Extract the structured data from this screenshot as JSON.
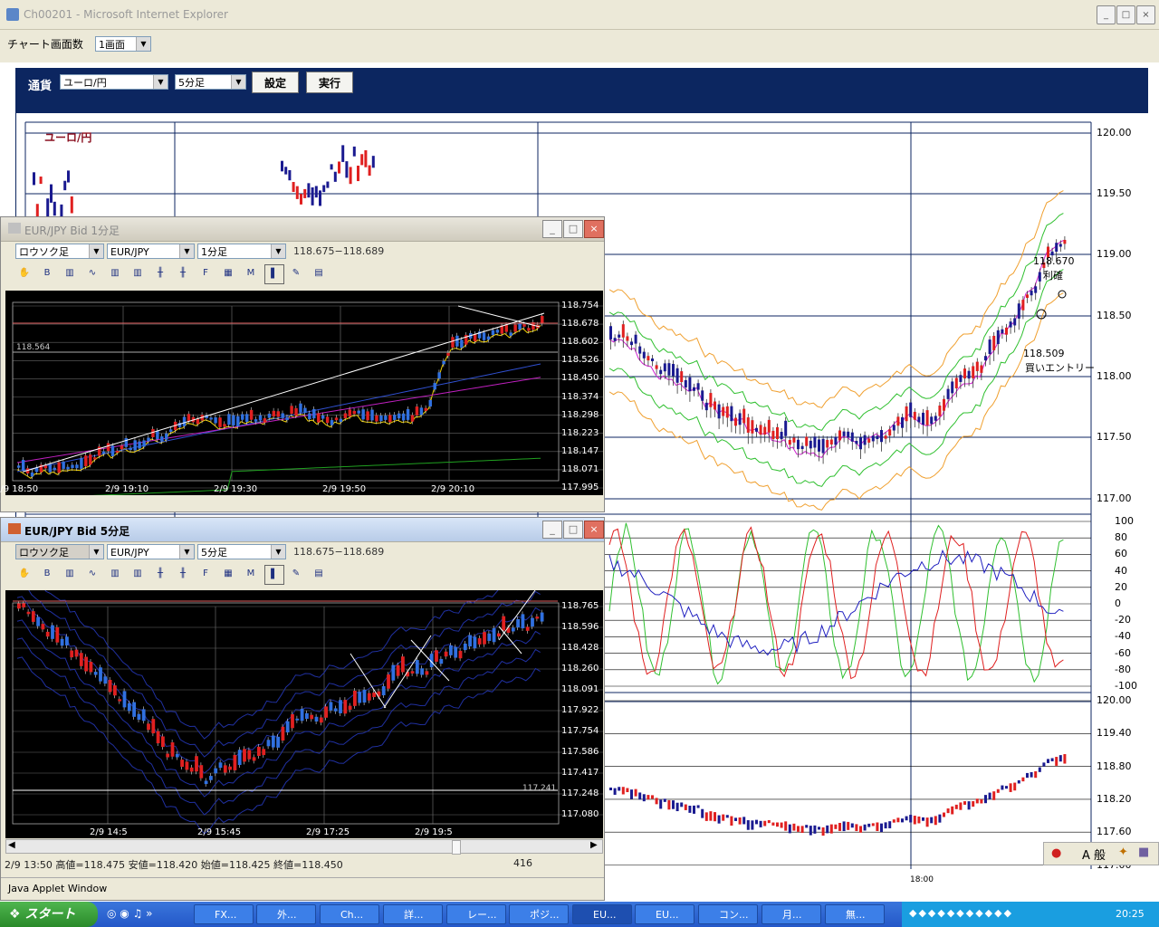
{
  "ie": {
    "title": "Ch00201 - Microsoft Internet Explorer"
  },
  "page": {
    "screens_label": "チャート画面数",
    "screens_value": "1画面"
  },
  "toolbar": {
    "currency_label": "通貨",
    "currency_value": "ユーロ/円",
    "interval_value": "5分足",
    "set_button": "設定",
    "run_button": "実行"
  },
  "main_chart": {
    "title": "ユーロ/円",
    "price_ticks": [
      "120.00",
      "119.50",
      "119.00",
      "118.50",
      "118.00",
      "117.50",
      "117.00"
    ],
    "annotation_sell_price": "118.670",
    "annotation_sell_label": "利確",
    "annotation_buy_price": "118.509",
    "annotation_buy_label": "買いエントリー",
    "osc_ticks": [
      "100",
      "80",
      "60",
      "40",
      "20",
      "0",
      "-20",
      "-40",
      "-60",
      "-80",
      "-100"
    ],
    "bottom_ticks": [
      "120.00",
      "119.40",
      "118.80",
      "118.20",
      "117.60",
      "117.00"
    ],
    "time_label": "18:00"
  },
  "win1": {
    "title": "EUR/JPY  Bid  1分足",
    "type_select": "ロウソク足",
    "pair_select": "EUR/JPY",
    "interval_select": "1分足",
    "range": "118.675−118.689",
    "hline_label": "118.564",
    "y_ticks": [
      "118.754",
      "118.678",
      "118.602",
      "118.526",
      "118.450",
      "118.374",
      "118.298",
      "118.223",
      "118.147",
      "118.071",
      "117.995"
    ],
    "x_ticks": [
      "2/9 18:50",
      "2/9 19:10",
      "2/9 19:30",
      "2/9 19:50",
      "2/9 20:10"
    ]
  },
  "win2": {
    "title": "EUR/JPY  Bid  5分足",
    "type_select": "ロウソク足",
    "pair_select": "EUR/JPY",
    "interval_select": "5分足",
    "range": "118.675−118.689",
    "low_label": "117.241",
    "y_ticks": [
      "118.765",
      "118.596",
      "118.428",
      "118.260",
      "118.091",
      "117.922",
      "117.754",
      "117.586",
      "117.417",
      "117.248",
      "117.080"
    ],
    "x_ticks": [
      "2/9 14:5",
      "2/9 15:45",
      "2/9 17:25",
      "2/9 19:5"
    ],
    "status_left": "2/9 13:50   高値=118.475  安値=118.420  始値=118.425  終値=118.450",
    "status_right": "416",
    "java_label": "Java Applet Window"
  },
  "tray_icons": {
    "lang": "A 般"
  },
  "taskbar": {
    "start": "スタート",
    "tasks": [
      "FX...",
      "外...",
      "Ch...",
      "詳...",
      "レー...",
      "ポジ...",
      "EU...",
      "EU...",
      "コン...",
      "月...",
      "無..."
    ],
    "clock": "20:25"
  },
  "colors": {
    "candle_up": "#e02020",
    "candle_down": "#1a1a90",
    "navy": "#0c2660"
  }
}
